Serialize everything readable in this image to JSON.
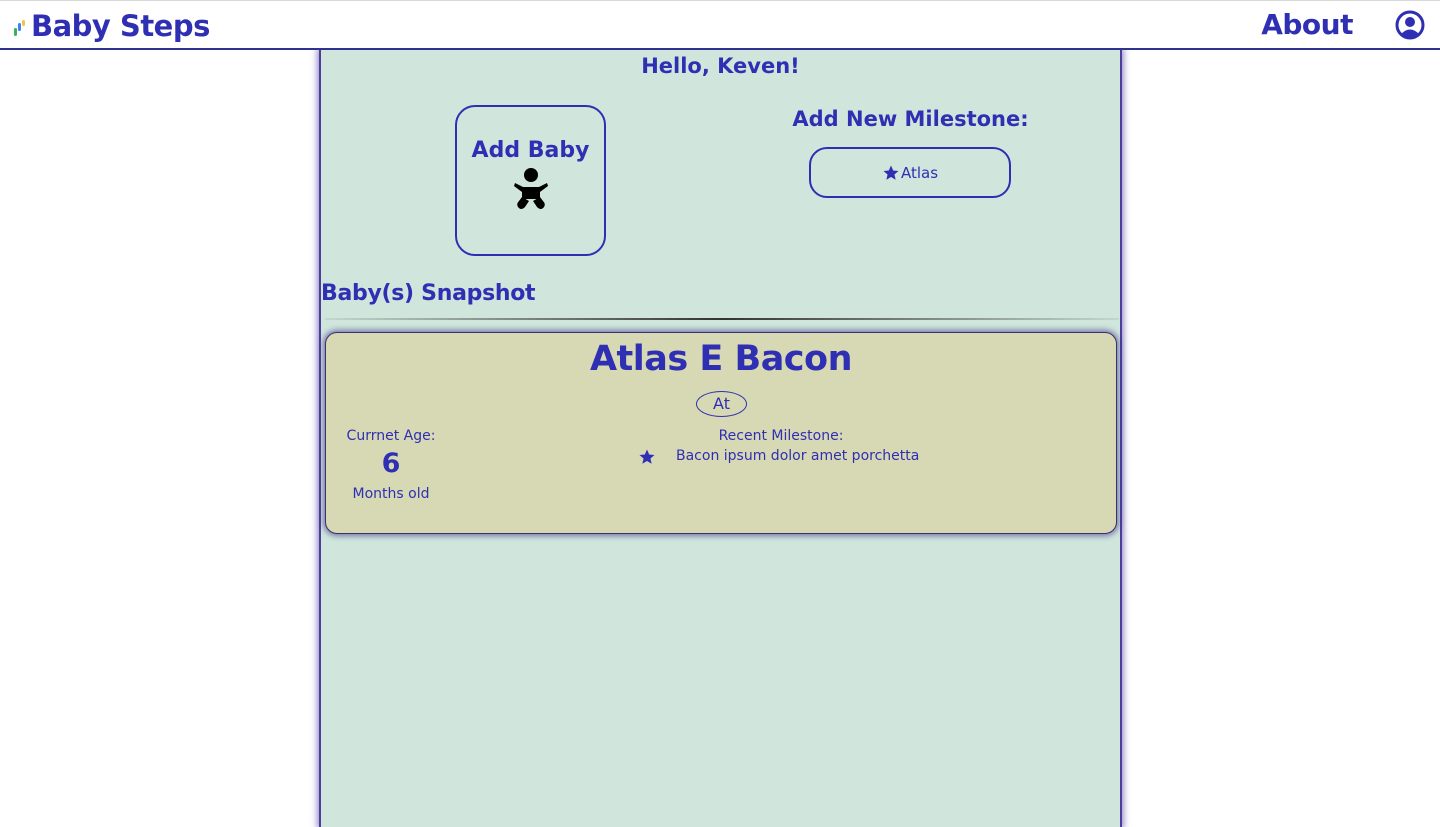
{
  "header": {
    "brand": "Baby Steps",
    "about": "About",
    "colors": {
      "accent": "#2f2fb3",
      "logo_blue": "#3b82f6",
      "logo_yellow": "#f4c542",
      "logo_green": "#3fae5a"
    }
  },
  "main": {
    "greeting": "Hello, Keven!",
    "add_baby_label": "Add Baby",
    "milestone_title": "Add New Milestone:",
    "milestone_button": "Atlas",
    "snapshot_title": "Baby(s) Snapshot",
    "background": "#d0e6dc"
  },
  "baby_card": {
    "name": "Atlas E Bacon",
    "initials": "At",
    "age_label": "Currnet Age:",
    "age_value": "6",
    "age_unit": "Months old",
    "recent_label": "Recent Milestone:",
    "recent_milestone": "Bacon ipsum dolor amet porchetta",
    "background": "#d7d8b4"
  }
}
